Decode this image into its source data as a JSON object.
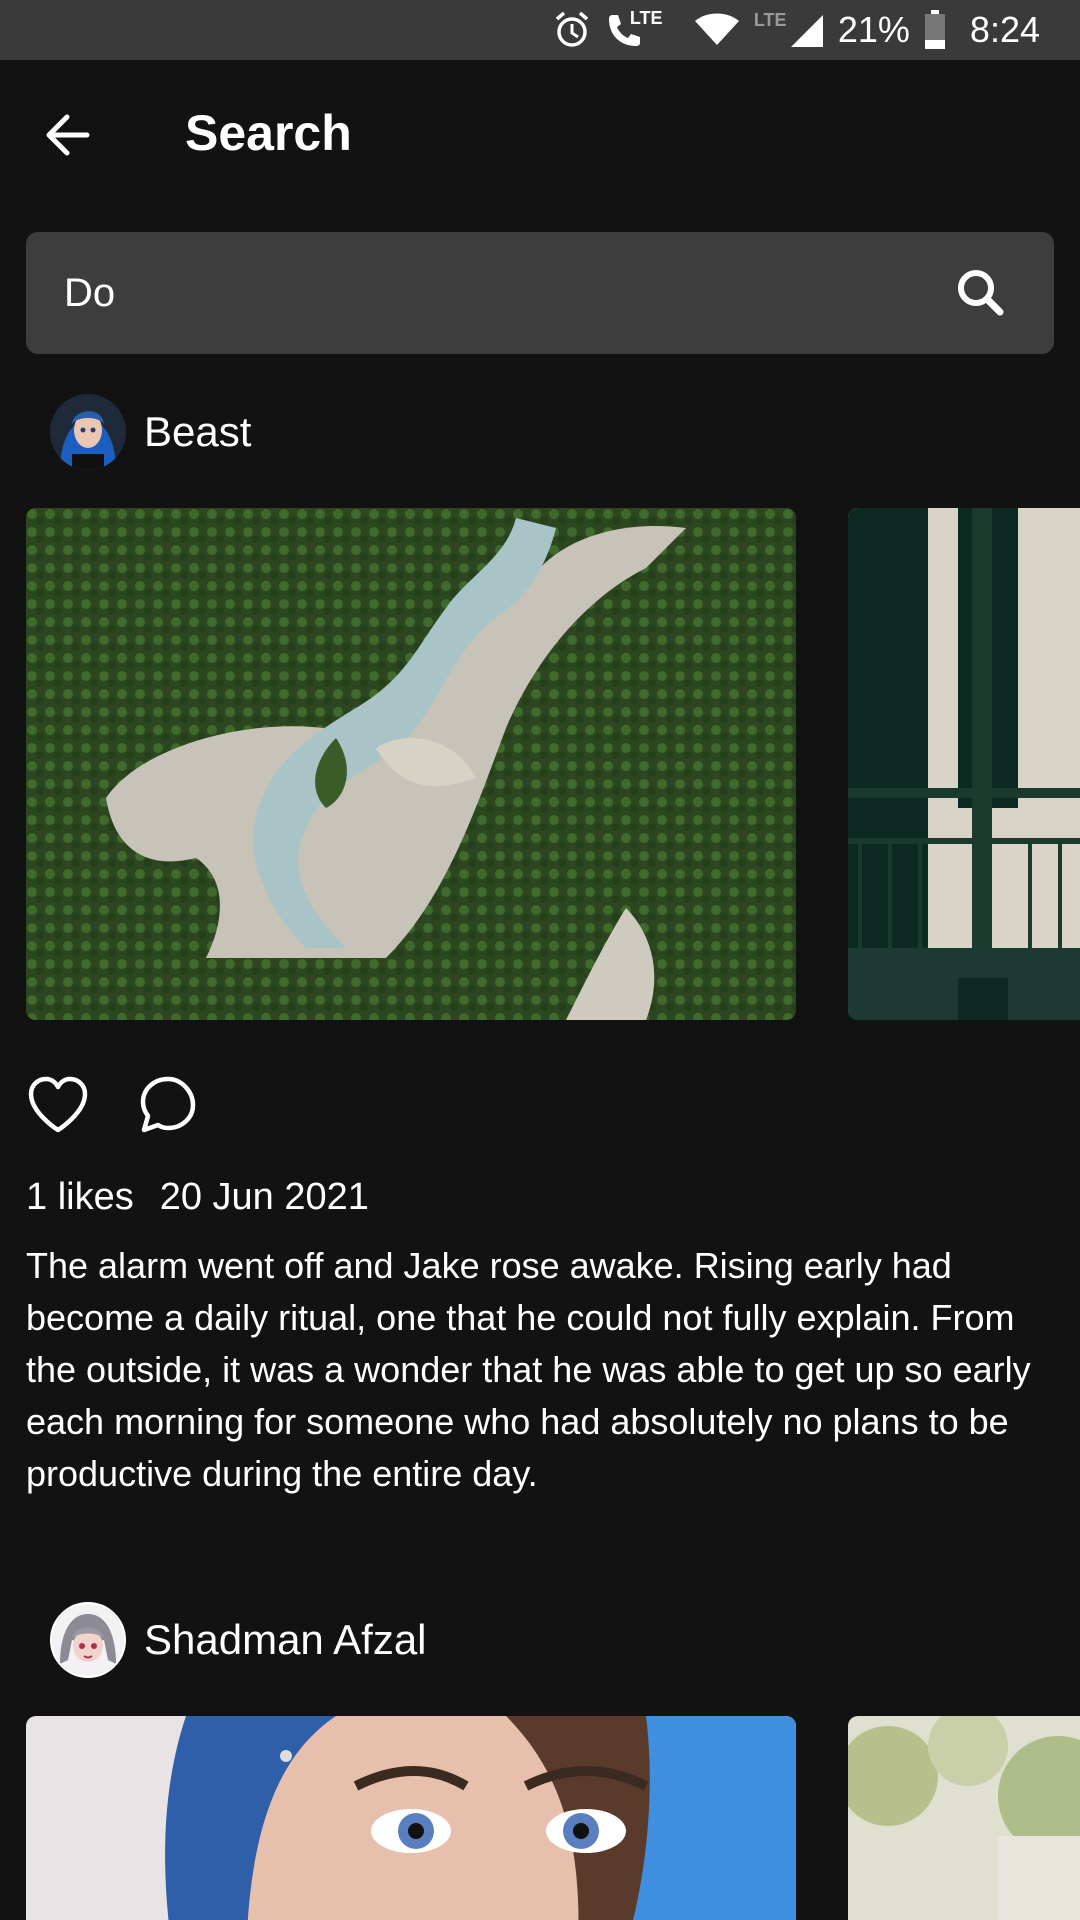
{
  "status_bar": {
    "lte_call": "LTE",
    "lte_signal": "LTE",
    "battery": "21%",
    "time": "8:24"
  },
  "header": {
    "title": "Search"
  },
  "search": {
    "value": "Do",
    "placeholder": ""
  },
  "posts": [
    {
      "username": "Beast",
      "likes": "1 likes",
      "date": "20 Jun 2021",
      "caption": "The alarm went off and Jake rose awake. Rising early had become a daily ritual, one that he could not fully explain. From the outside, it was a wonder that he was able to get up so early each morning for someone who had absolutely no plans to be productive during the entire day."
    },
    {
      "username": "Shadman Afzal"
    }
  ],
  "colors": {
    "background": "#121212",
    "status_bar": "#3a3a3a",
    "search_field": "#3d3d3d"
  }
}
